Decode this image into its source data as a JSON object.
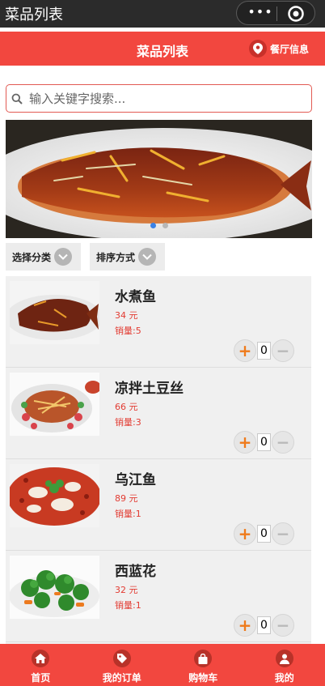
{
  "window": {
    "title": "菜品列表"
  },
  "capsule": {
    "more_glyph": "•••"
  },
  "header": {
    "title": "菜品列表",
    "restaurant_info": "餐厅信息"
  },
  "search": {
    "placeholder": "输入关键字搜索..."
  },
  "banner": {
    "slide_count": 2,
    "active_index": 0
  },
  "filters": {
    "category": "选择分类",
    "sort": "排序方式"
  },
  "dishes": [
    {
      "name": "水煮鱼",
      "price": "34 元",
      "sales": "销量:5",
      "qty": "0"
    },
    {
      "name": "凉拌土豆丝",
      "price": "66 元",
      "sales": "销量:3",
      "qty": "0"
    },
    {
      "name": "乌江鱼",
      "price": "89 元",
      "sales": "销量:1",
      "qty": "0"
    },
    {
      "name": "西蓝花",
      "price": "32 元",
      "sales": "销量:1",
      "qty": "0"
    }
  ],
  "stepper": {
    "plus": "+",
    "minus": "−"
  },
  "tabbar": [
    {
      "label": "首页",
      "icon": "home-icon"
    },
    {
      "label": "我的订单",
      "icon": "order-tag-icon"
    },
    {
      "label": "购物车",
      "icon": "shopping-bag-icon"
    },
    {
      "label": "我的",
      "icon": "user-icon"
    }
  ],
  "colors": {
    "brand_red": "#f2473f",
    "price_red": "#e23b32",
    "plus_orange": "#ef7a1a",
    "indicator_blue": "#3b82e6"
  }
}
